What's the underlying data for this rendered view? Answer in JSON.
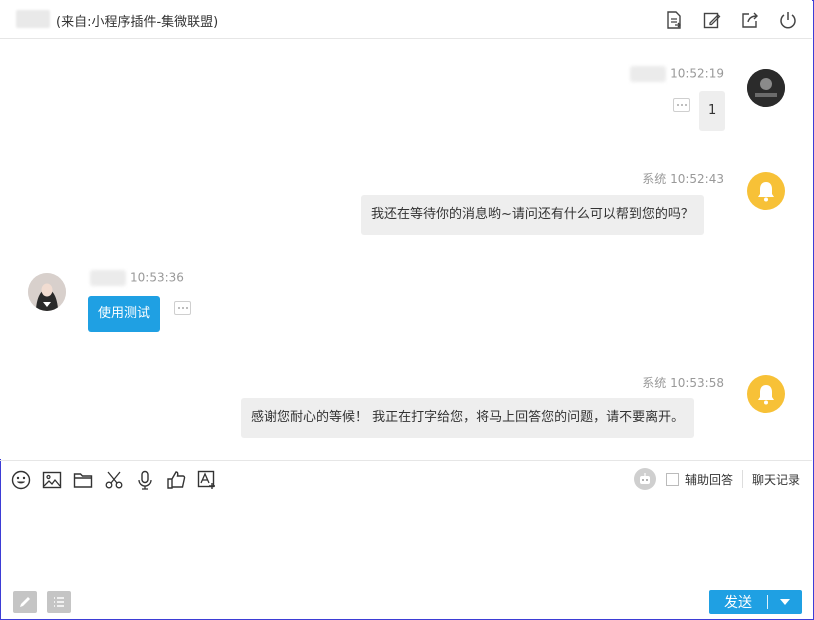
{
  "header": {
    "title": "(来自:小程序插件-集微联盟)",
    "icons": [
      "transfer-icon",
      "edit-note-icon",
      "share-out-icon",
      "power-icon"
    ]
  },
  "messages": [
    {
      "side": "right",
      "sender": "",
      "time": "10:52:19",
      "text": "1",
      "avatar": "user-avatar"
    },
    {
      "side": "right",
      "sender": "系统",
      "time": "10:52:43",
      "text": "我还在等待你的消息哟~请问还有什么可以帮到您的吗？",
      "avatar": "bell-avatar"
    },
    {
      "side": "left",
      "sender": "",
      "time": "10:53:36",
      "text": "使用测试",
      "avatar": "customer-avatar"
    },
    {
      "side": "right",
      "sender": "系统",
      "time": "10:53:58",
      "text": "感谢您耐心的等候！ 我正在打字给您，将马上回答您的问题，请不要离开。",
      "avatar": "bell-avatar"
    }
  ],
  "toolbar": {
    "tools": [
      "emoji-icon",
      "image-icon",
      "folder-icon",
      "scissors-icon",
      "microphone-icon",
      "thumbs-up-icon",
      "text-icon"
    ],
    "assist_label": "辅助回答",
    "history_label": "聊天记录"
  },
  "send": {
    "label": "发送"
  },
  "colors": {
    "accent": "#1fa0e3",
    "bell": "#f7c137",
    "bubble_gray": "#eeeeee"
  }
}
